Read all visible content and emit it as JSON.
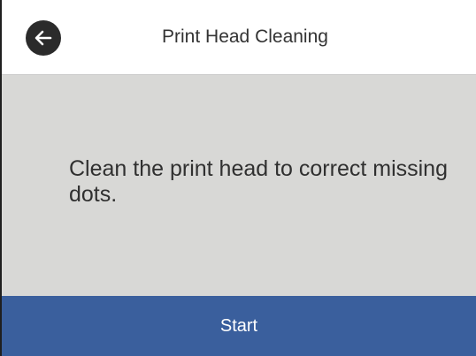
{
  "header": {
    "back_icon": "arrow-left-icon",
    "title": "Print Head Cleaning"
  },
  "main": {
    "message": "Clean the print head to correct missing dots."
  },
  "footer": {
    "start_label": "Start"
  },
  "colors": {
    "header_bg": "#ffffff",
    "content_bg": "#d8d8d6",
    "footer_bg": "#3a5f9d",
    "back_button_bg": "#2b2b2b"
  }
}
